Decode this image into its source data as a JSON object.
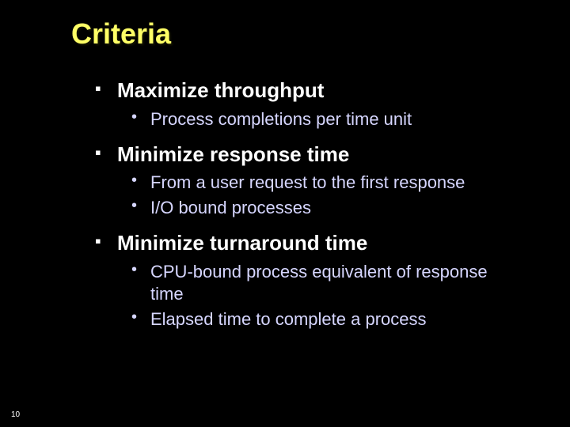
{
  "slide": {
    "title": "Criteria",
    "items": [
      {
        "heading": "Maximize throughput",
        "sub": [
          "Process completions per time unit"
        ]
      },
      {
        "heading": "Minimize response time",
        "sub": [
          "From a user request to the first response",
          "I/O bound processes"
        ]
      },
      {
        "heading": "Minimize turnaround time",
        "sub": [
          "CPU-bound process equivalent of response time",
          "Elapsed time to complete a process"
        ]
      }
    ],
    "page_number": "10"
  }
}
